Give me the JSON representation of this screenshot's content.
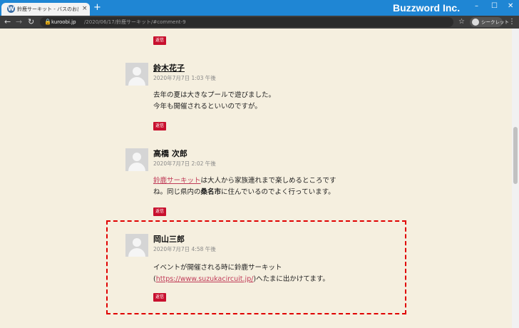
{
  "browser": {
    "tab_title": "鈴鹿サーキット - バスのお出かけブログ",
    "tab_close": "×",
    "new_tab": "+",
    "brand": "Buzzword Inc.",
    "window_controls": {
      "minimize": "–",
      "maximize": "☐",
      "close": "✕"
    },
    "url_host": "kuroobi.jp",
    "url_path": "/2020/06/17/鈴鹿サーキット/#comment-9",
    "incognito_label": "シークレット"
  },
  "comments": [
    {
      "reply_label": "返信"
    },
    {
      "author": "鈴木花子",
      "date": "2020年7月7日 1:03 午後",
      "lines": [
        "去年の夏は大きなプールで遊びました。",
        "今年も開催されるといいのですが。"
      ],
      "reply_label": "返信"
    },
    {
      "author": "高橋 次郎",
      "date": "2020年7月7日 2:02 午後",
      "line1_link": "鈴鹿サーキット",
      "line1_rest": "は大人から家族連れまで楽しめるところです",
      "line2_pre": "ね。同じ県内の",
      "line2_bold": "桑名市",
      "line2_post": "に住んでいるのでよく行っています。",
      "reply_label": "返信"
    },
    {
      "author": "岡山三郎",
      "date": "2020年7月7日 4:58 午後",
      "line1": "イベントが開催される時に鈴鹿サーキット",
      "line2_pre": "(",
      "line2_link": "https://www.suzukacircuit.jp/",
      "line2_post": ")へたまに出かけてます。",
      "reply_label": "返信"
    }
  ],
  "colors": {
    "accent": "#c8102e",
    "link": "#c03a57",
    "highlight": "#e00000",
    "background": "#f5efdf"
  }
}
